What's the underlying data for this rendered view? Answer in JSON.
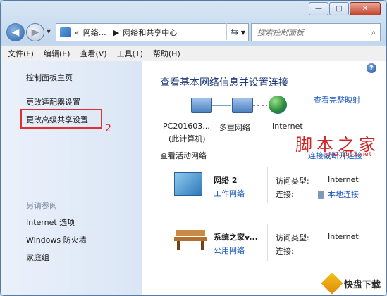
{
  "window": {
    "caption_buttons": [
      "—",
      "□",
      "✕"
    ]
  },
  "address": {
    "crumb_overflow": "«",
    "crumb_1": "网络…",
    "crumb_sep": "▶",
    "crumb_2": "网络和共享中心",
    "search_placeholder": "搜索控制面板"
  },
  "menu": [
    "文件(F)",
    "编辑(E)",
    "查看(V)",
    "工具(T)",
    "帮助(H)"
  ],
  "sidebar": {
    "home": "控制面板主页",
    "adapter": "更改适配器设置",
    "advanced_sharing": "更改高级共享设置",
    "annotation_number": "2",
    "see_also": "另请参阅",
    "links": [
      "Internet 选项",
      "Windows 防火墙",
      "家庭组"
    ]
  },
  "main": {
    "help_icon": "?",
    "title": "查看基本网络信息并设置连接",
    "full_map_link": "查看完整映射",
    "nodes": {
      "computer_line1": "PC201603...",
      "computer_line2": "(此计算机)",
      "network": "多重网络",
      "internet": "Internet"
    },
    "active_networks_heading": "查看活动网络",
    "connect_disconnect_link": "连接或断开连接",
    "networks": [
      {
        "name": "网络  2",
        "type": "工作网络",
        "access_label": "访问类型:",
        "access_value": "Internet",
        "connection_label": "连接:",
        "connection_value": "本地连接"
      },
      {
        "name": "系统之家v...",
        "type": "公用网络",
        "access_label": "访问类型:",
        "access_value": "Internet",
        "connection_label": "连接:",
        "connection_value": ""
      }
    ]
  },
  "watermarks": {
    "site_1": "脚本之家",
    "site_1_url": "www.jb51.net",
    "site_2": "快盘下载"
  }
}
